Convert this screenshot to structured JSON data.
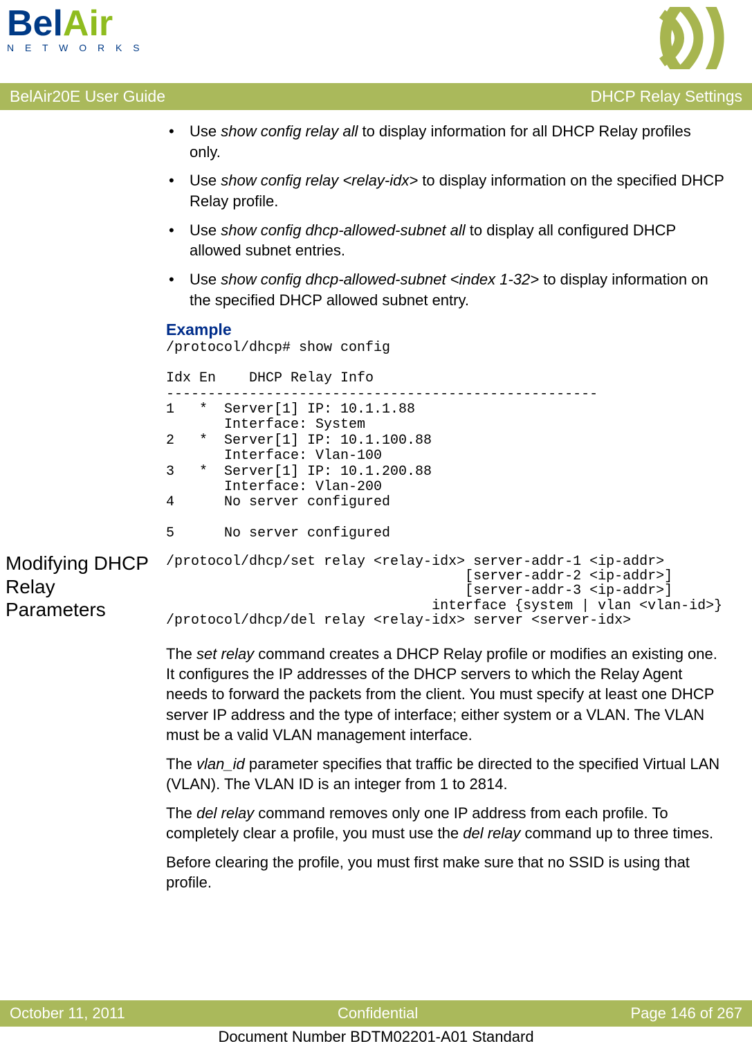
{
  "header": {
    "logo_main_1": "Bel",
    "logo_main_2": "Air",
    "logo_sub": "N E T W O R K S"
  },
  "banner": {
    "left": "BelAir20E User Guide",
    "right": "DHCP Relay Settings"
  },
  "bullets": [
    {
      "pre": "Use ",
      "cmd": "show config relay all",
      "post": " to display information for all DHCP Relay profiles only."
    },
    {
      "pre": "Use ",
      "cmd": "show config relay <relay-idx>",
      "post": " to display information on the specified DHCP Relay profile."
    },
    {
      "pre": "Use ",
      "cmd": "show config dhcp-allowed-subnet all",
      "post": " to display all configured DHCP allowed subnet entries."
    },
    {
      "pre": "Use ",
      "cmd": "show config dhcp-allowed-subnet <index 1-32>",
      "post": " to display information on the specified DHCP allowed subnet entry."
    }
  ],
  "example_heading": "Example",
  "example_code": "/protocol/dhcp# show config\n\nIdx En    DHCP Relay Info\n----------------------------------------------------\n1   *  Server[1] IP: 10.1.1.88\n       Interface: System\n2   *  Server[1] IP: 10.1.100.88\n       Interface: Vlan-100\n3   *  Server[1] IP: 10.1.200.88\n       Interface: Vlan-200\n4      No server configured\n\n5      No server configured",
  "section_title_line1": "Modifying DHCP",
  "section_title_line2": "Relay Parameters",
  "syntax_code": "/protocol/dhcp/set relay <relay-idx> server-addr-1 <ip-addr>\n                                    [server-addr-2 <ip-addr>]\n                                    [server-addr-3 <ip-addr>]\n                                interface {system | vlan <vlan-id>}\n/protocol/dhcp/del relay <relay-idx> server <server-idx>",
  "para1": {
    "p1": "The ",
    "cmd1": "set relay",
    "p2": " command creates a DHCP Relay profile or modifies an existing one. It configures the IP addresses of the DHCP servers to which the Relay Agent needs to forward the packets from the client. You must specify at least one DHCP server IP address and the type of interface; either system or a VLAN. The VLAN must be a valid VLAN management interface."
  },
  "para2": {
    "p1": "The ",
    "cmd1": "vlan_id",
    "p2": " parameter specifies that traffic be directed to the specified Virtual LAN (VLAN). The VLAN ID is an integer from 1 to 2814."
  },
  "para3": {
    "p1": "The ",
    "cmd1": "del relay",
    "p2": " command removes only one IP address from each profile. To completely clear a profile, you must use the ",
    "cmd2": "del relay",
    "p3": " command up to three times."
  },
  "para4": "Before clearing the profile, you must first make sure that no SSID is using that profile.",
  "footer": {
    "left": "October 11, 2011",
    "center": "Confidential",
    "right": "Page 146 of 267",
    "sub": "Document Number BDTM02201-A01 Standard"
  }
}
